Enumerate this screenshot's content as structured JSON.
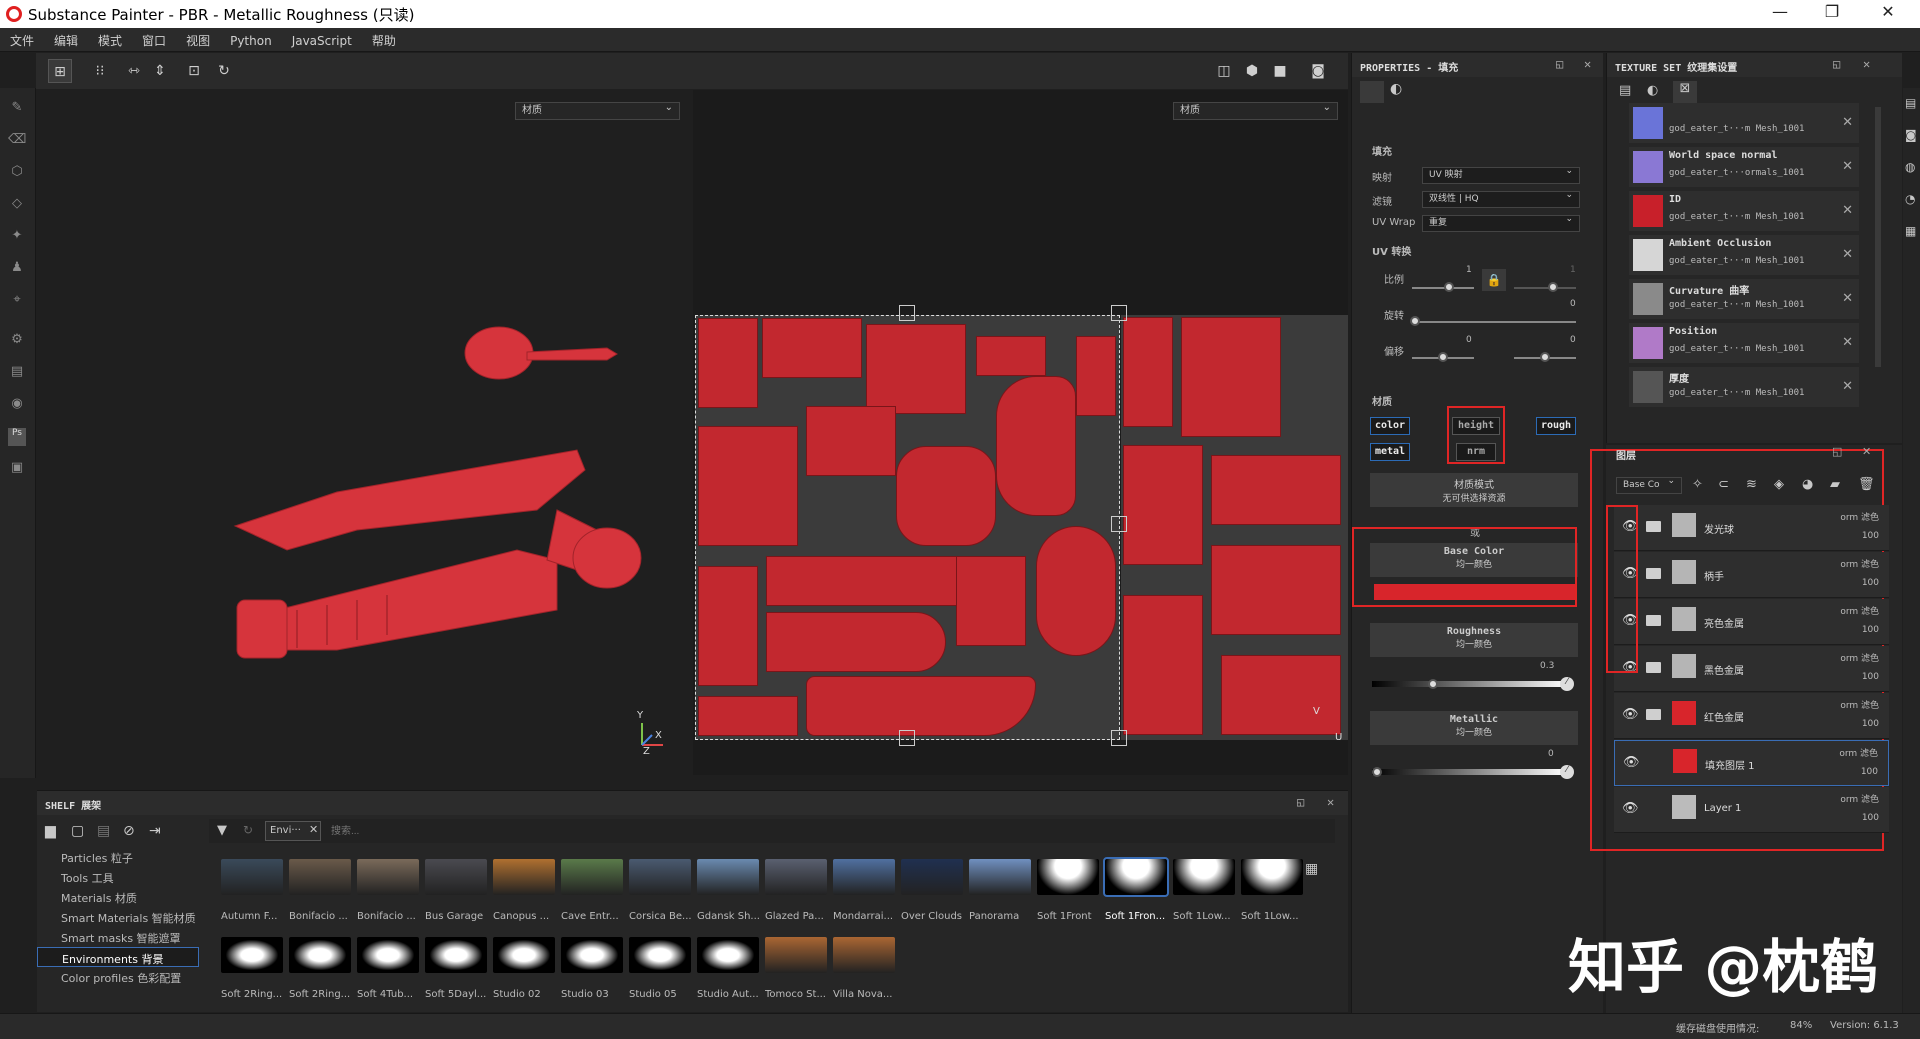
{
  "window": {
    "title": "Substance Painter - PBR - Metallic Roughness (只读)",
    "minimize": "—",
    "restore": "❐",
    "close": "✕"
  },
  "menu": [
    "文件",
    "编辑",
    "模式",
    "窗口",
    "视图",
    "Python",
    "JavaScript",
    "帮助"
  ],
  "viewport": {
    "left_material": "材质",
    "right_material": "材质",
    "axis_y": "Y",
    "axis_x": "X",
    "axis_z": "Z",
    "uv_v": "V",
    "uv_u": "U"
  },
  "shelf": {
    "title": "SHELF 展架",
    "filter_tag": "Envi···",
    "search_placeholder": "搜索...",
    "categories": [
      "Particles 粒子",
      "Tools 工具",
      "Materials 材质",
      "Smart Materials 智能材质",
      "Smart masks 智能遮罩",
      "Environments 背景",
      "Color profiles 色彩配置"
    ],
    "selected_category": "Environments 背景",
    "row1": [
      "Autumn F...",
      "Bonifacio ...",
      "Bonifacio ...",
      "Bus Garage",
      "Canopus ...",
      "Cave Entr...",
      "Corsica Be...",
      "Gdansk Sh...",
      "Glazed Pa...",
      "Mondarrai...",
      "Over Clouds",
      "Panorama",
      "Soft 1Front",
      "Soft 1Fron...",
      "Soft 1Low...",
      "Soft 1Low..."
    ],
    "row2": [
      "Soft 2Ring...",
      "Soft 2Ring...",
      "Soft 4Tub...",
      "Soft 5Dayl...",
      "Studio 02",
      "Studio 03",
      "Studio 05",
      "Studio Aut...",
      "Tomoco St...",
      "Villa Nova..."
    ],
    "selected_item": "Soft 1Fron..."
  },
  "properties": {
    "title": "PROPERTIES - 填充",
    "fill_section": "填充",
    "mapping_label": "映射",
    "mapping_value": "UV 映射",
    "filter_label": "滤镜",
    "filter_value": "双线性 | HQ",
    "uvwrap_label": "UV Wrap",
    "uvwrap_value": "重复",
    "uv_transform": "UV 转换",
    "scale_label": "比例",
    "scale_value": "1",
    "scale_value2": "1",
    "rotate_label": "旋转",
    "rotate_value": "0",
    "offset_label": "偏移",
    "offset_value1": "0",
    "offset_value2": "0",
    "material_section": "材质",
    "channels": {
      "color": "color",
      "height": "height",
      "rough": "rough",
      "metal": "metal",
      "nrm": "nrm"
    },
    "material_mode": "材质模式",
    "material_mode_sub": "无可供选择资源",
    "or": "或",
    "base_color": "Base Color",
    "base_color_sub": "均一颜色",
    "base_color_hex": "#d8252b",
    "roughness": "Roughness",
    "roughness_sub": "均一颜色",
    "roughness_value": "0.3",
    "roughness_level": 0.3,
    "metallic": "Metallic",
    "metallic_sub": "均一颜色",
    "metallic_value": "0",
    "metallic_level": 0
  },
  "texture_set": {
    "title": "TEXTURE SET 纹理集设置",
    "items": [
      {
        "name": "",
        "file": "god_eater_t···m Mesh_1001",
        "color": "#6a74d8"
      },
      {
        "name": "World space normal",
        "file": "god_eater_t···ormals_1001",
        "color": "#8a78d4"
      },
      {
        "name": "ID",
        "file": "god_eater_t···m Mesh_1001",
        "color": "#c8202a"
      },
      {
        "name": "Ambient Occlusion",
        "file": "god_eater_t···m Mesh_1001",
        "color": "#d6d6d6"
      },
      {
        "name": "Curvature 曲率",
        "file": "god_eater_t···m Mesh_1001",
        "color": "#8a8a8a"
      },
      {
        "name": "Position",
        "file": "god_eater_t···m Mesh_1001",
        "color": "#b07ac8"
      },
      {
        "name": "厚度",
        "file": "god_eater_t···m Mesh_1001",
        "color": "#555555"
      }
    ]
  },
  "layers": {
    "title": "图层",
    "channel_select": "Base Co",
    "items": [
      {
        "name": "发光球",
        "blend": "orm  滤色",
        "opacity": "100",
        "swatch": "#b5b5b5",
        "folder": true
      },
      {
        "name": "柄手",
        "blend": "orm  滤色",
        "opacity": "100",
        "swatch": "#b5b5b5",
        "folder": true
      },
      {
        "name": "亮色金属",
        "blend": "orm  滤色",
        "opacity": "100",
        "swatch": "#b5b5b5",
        "folder": true
      },
      {
        "name": "黑色金属",
        "blend": "orm  滤色",
        "opacity": "100",
        "swatch": "#b5b5b5",
        "folder": true
      },
      {
        "name": "红色金属",
        "blend": "orm  滤色",
        "opacity": "100",
        "swatch": "#d8252b",
        "folder": true
      },
      {
        "name": "填充图层 1",
        "blend": "orm  滤色",
        "opacity": "100",
        "swatch": "#d8252b",
        "folder": false
      },
      {
        "name": "Layer 1",
        "blend": "orm  滤色",
        "opacity": "100",
        "swatch": "#bbbbbb",
        "folder": false
      }
    ]
  },
  "status": {
    "cache": "缓存磁盘使用情况:",
    "percent": "84%",
    "version": "Version: 6.1.3"
  },
  "watermark": "知乎 @枕鹤",
  "colors": {
    "accent": "#2c6bb6",
    "highlight": "#e02525",
    "red_material": "#d6343c"
  }
}
